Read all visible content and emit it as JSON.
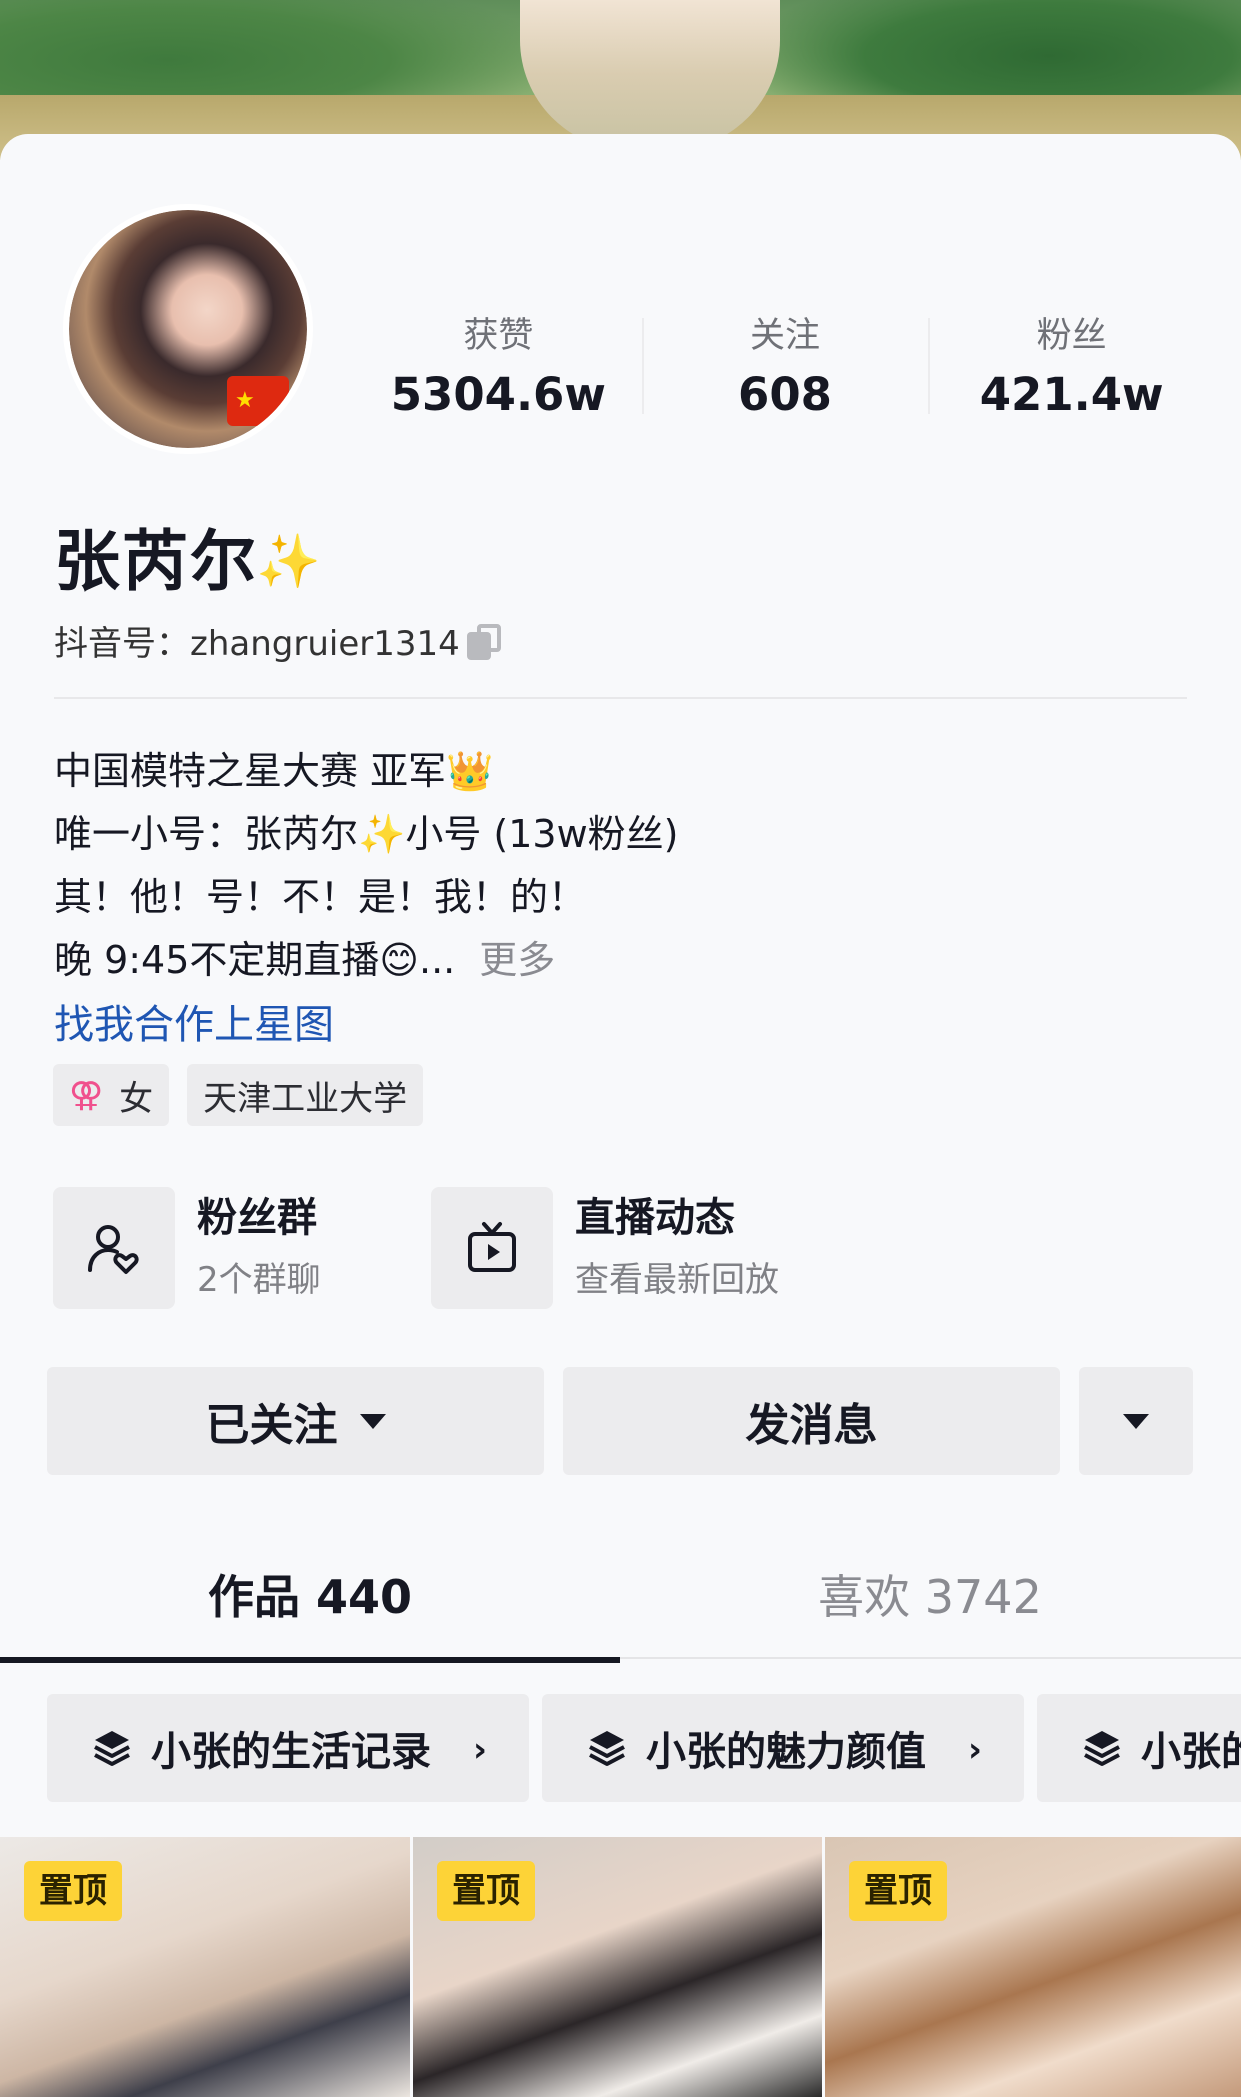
{
  "stats": [
    {
      "label": "获赞",
      "value": "5304.6w"
    },
    {
      "label": "关注",
      "value": "608"
    },
    {
      "label": "粉丝",
      "value": "421.4w"
    }
  ],
  "profile": {
    "name": "张芮尔",
    "name_emoji": "✨",
    "douyin_id": "抖音号：zhangruier1314"
  },
  "bio": {
    "line1": "中国模特之星大赛 亚军👑",
    "line2": "唯一小号：张芮尔✨小号 (13w粉丝)",
    "line3": "其！他！号！不！是！我！的！",
    "line4": "晚 9:45不定期直播😊...",
    "more": "更多"
  },
  "link": "找我合作上星图",
  "tags": {
    "gender_icon": "⚢",
    "gender": "女",
    "school": "天津工业大学"
  },
  "features": [
    {
      "icon": "fan-group-icon",
      "title": "粉丝群",
      "subtitle": "2个群聊"
    },
    {
      "icon": "live-tv-icon",
      "title": "直播动态",
      "subtitle": "查看最新回放"
    }
  ],
  "actions": {
    "followed": "已关注",
    "message": "发消息"
  },
  "tabs": [
    {
      "label": "作品 440",
      "active": true
    },
    {
      "label": "喜欢 3742",
      "active": false
    }
  ],
  "collections": [
    {
      "icon": "layers-icon",
      "label": "小张的生活记录"
    },
    {
      "icon": "layers-icon",
      "label": "小张的魅力颜值"
    },
    {
      "icon": "layers-icon",
      "label": "小张的"
    }
  ],
  "videos": [
    {
      "badge": "置顶"
    },
    {
      "badge": "置顶"
    },
    {
      "badge": "置顶"
    }
  ],
  "colors": {
    "accent_link": "#1f56b3",
    "pin_badge": "#fdd337",
    "gender_icon": "#f0508d",
    "button_bg": "#ececee"
  }
}
